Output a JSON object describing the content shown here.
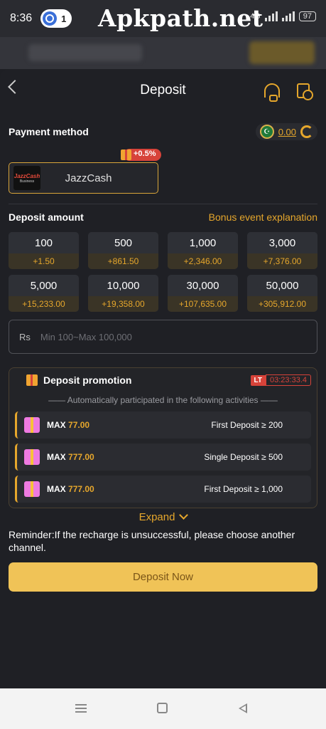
{
  "status_bar": {
    "time": "8:36",
    "notification_count": "1",
    "watermark": "Apkpath.net",
    "network": "4G",
    "battery": "97"
  },
  "header": {
    "title": "Deposit"
  },
  "payment": {
    "label": "Payment method",
    "balance": "0.00",
    "method_name": "JazzCash",
    "logo_text": [
      "JazzCash",
      "Business"
    ],
    "bonus_tag": "+0.5%"
  },
  "deposit": {
    "label": "Deposit amount",
    "bonus_link": "Bonus event explanation",
    "amounts": [
      {
        "value": "100",
        "bonus": "+1.50"
      },
      {
        "value": "500",
        "bonus": "+861.50"
      },
      {
        "value": "1,000",
        "bonus": "+2,346.00"
      },
      {
        "value": "3,000",
        "bonus": "+7,376.00"
      },
      {
        "value": "5,000",
        "bonus": "+15,233.00"
      },
      {
        "value": "10,000",
        "bonus": "+19,358.00"
      },
      {
        "value": "30,000",
        "bonus": "+107,635.00"
      },
      {
        "value": "50,000",
        "bonus": "+305,912.00"
      }
    ],
    "currency": "Rs",
    "placeholder": "Min 100~Max 100,000"
  },
  "promotion": {
    "title": "Deposit promotion",
    "timer_badge": "LT",
    "countdown": "03:23:33.4",
    "subtitle": "Automatically participated in the following activities",
    "rows": [
      {
        "max_label": "MAX",
        "max_value": "77.00",
        "condition": "First Deposit ≥ 200"
      },
      {
        "max_label": "MAX",
        "max_value": "777.00",
        "condition": "Single Deposit ≥ 500"
      },
      {
        "max_label": "MAX",
        "max_value": "777.00",
        "condition": "First Deposit ≥ 1,000"
      }
    ],
    "expand_label": "Expand"
  },
  "reminder": "Reminder:If the recharge is unsuccessful, please choose another channel.",
  "deposit_button": "Deposit Now",
  "colors": {
    "accent": "#e6a72c",
    "background": "#1f2025",
    "button": "#f0c357",
    "danger": "#d7433a"
  }
}
